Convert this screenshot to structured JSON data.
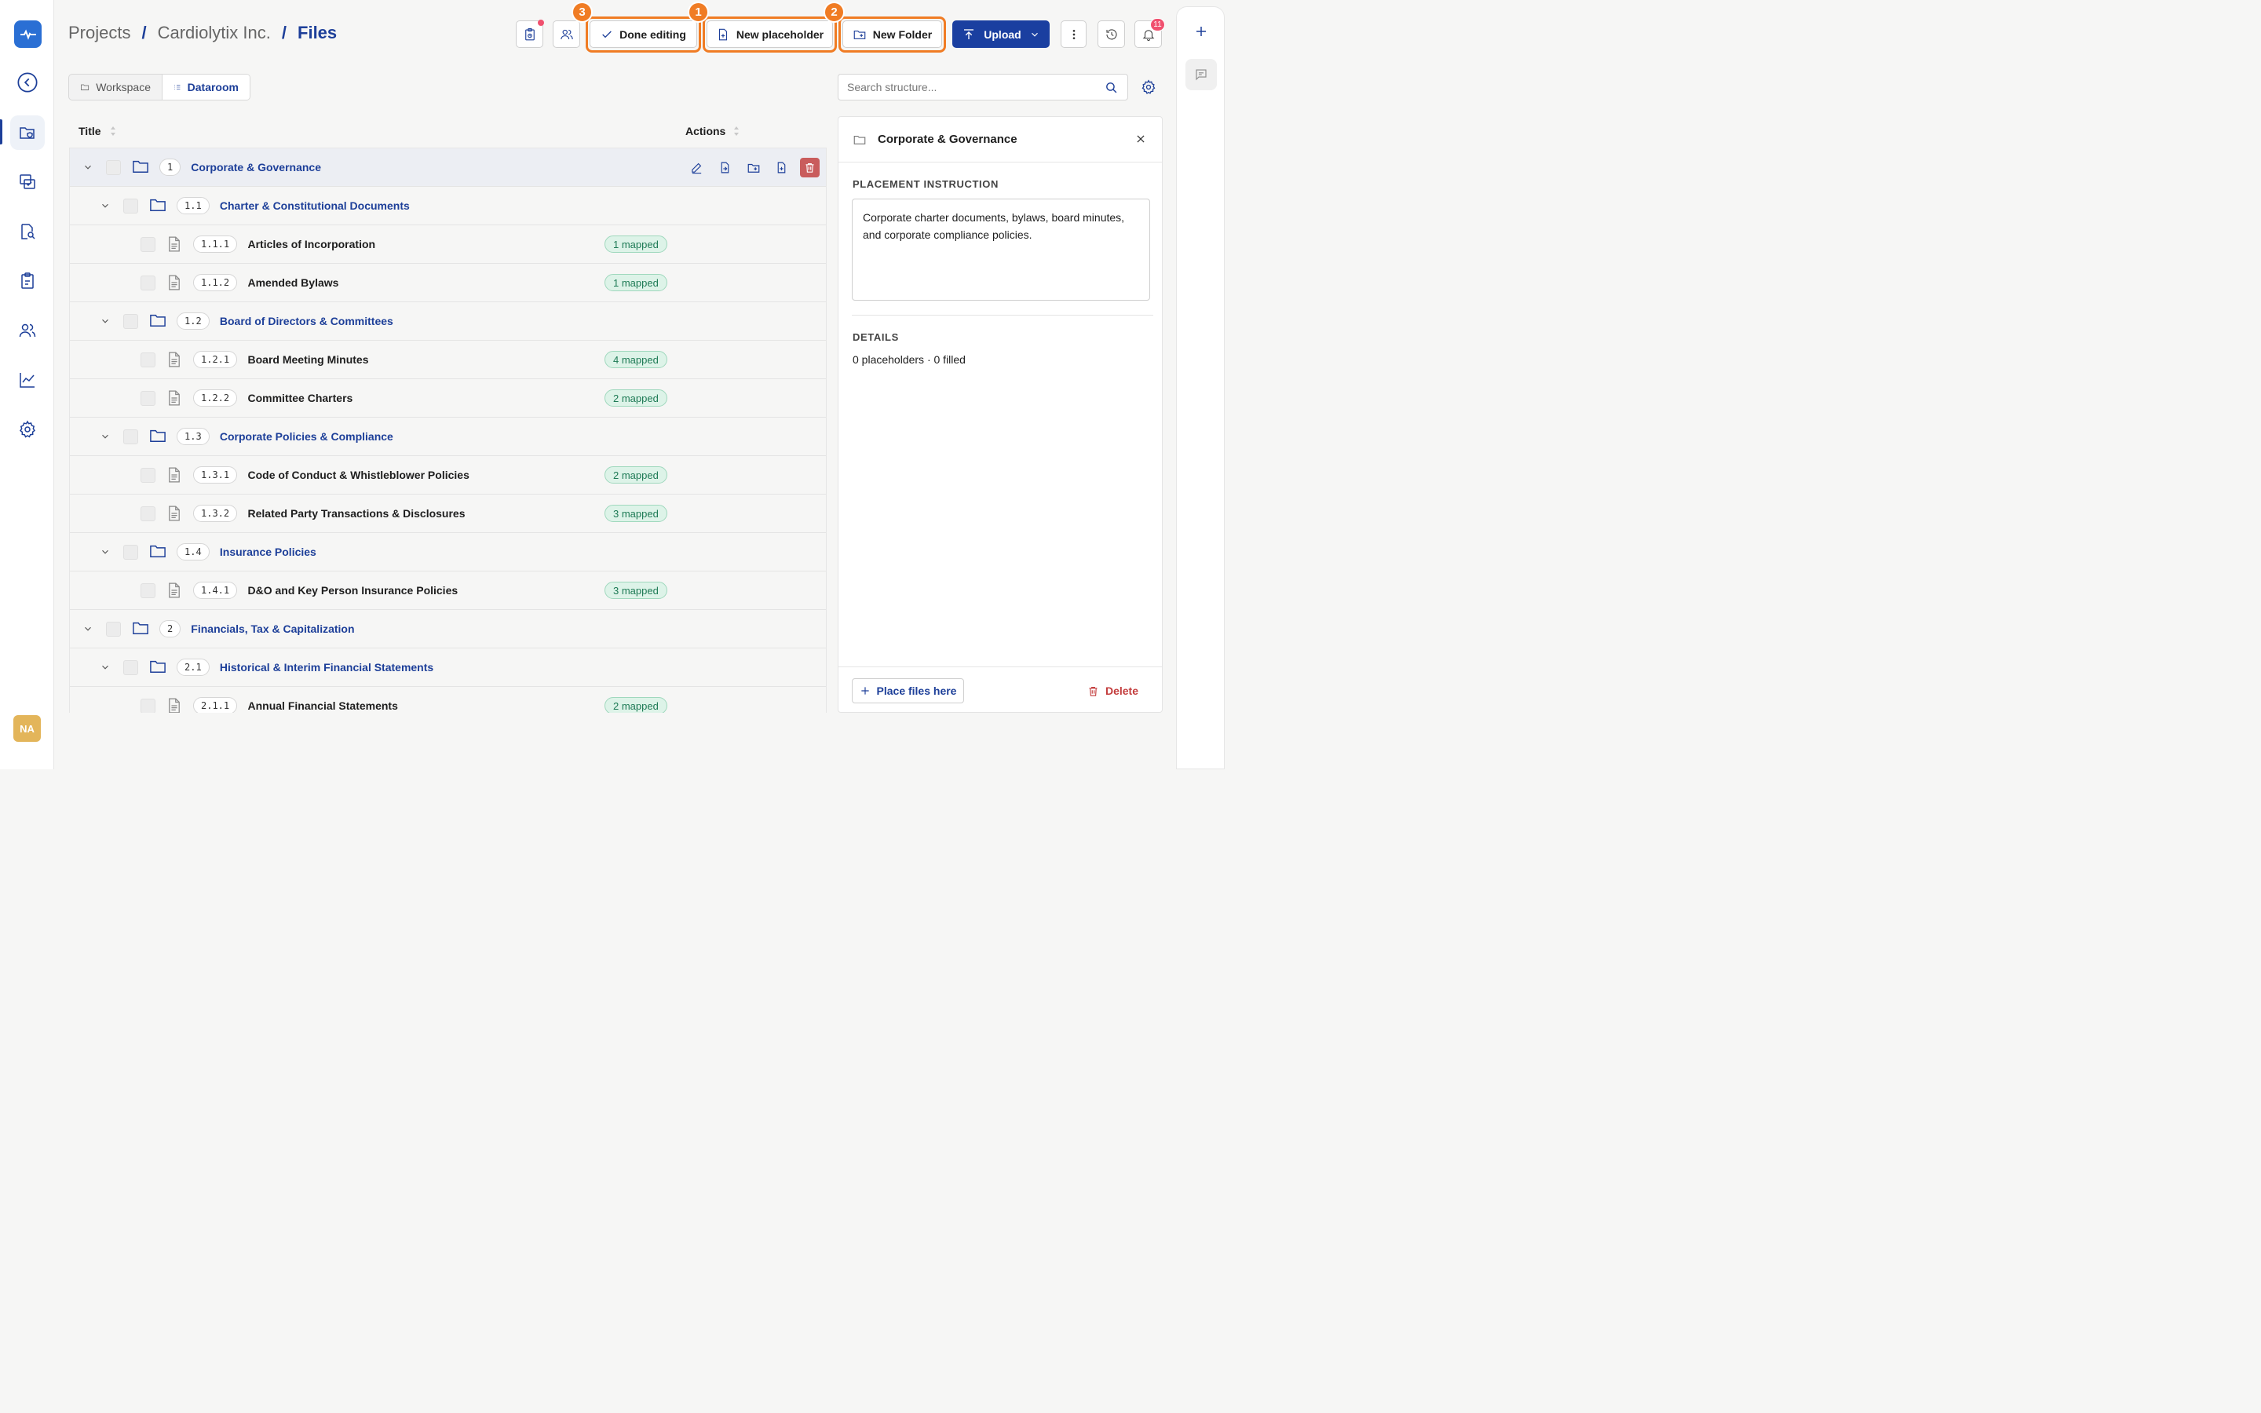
{
  "breadcrumb": {
    "projects": "Projects",
    "company": "Cardiolytix Inc.",
    "current": "Files",
    "sep": "/"
  },
  "header": {
    "done_editing": "Done editing",
    "new_placeholder": "New placeholder",
    "new_folder": "New Folder",
    "upload": "Upload",
    "notification_count": "11",
    "badges": {
      "done_editing": "3",
      "new_placeholder": "1",
      "new_folder": "2"
    }
  },
  "view_toggle": {
    "workspace": "Workspace",
    "dataroom": "Dataroom"
  },
  "table": {
    "col_title": "Title",
    "col_actions": "Actions"
  },
  "rows": [
    {
      "level": 0,
      "type": "folder",
      "num": "1",
      "title": "Corporate & Governance",
      "selected": true
    },
    {
      "level": 1,
      "type": "folder",
      "num": "1.1",
      "title": "Charter & Constitutional Documents"
    },
    {
      "level": 2,
      "type": "doc",
      "num": "1.1.1",
      "title": "Articles of Incorporation",
      "mapped": "1 mapped"
    },
    {
      "level": 2,
      "type": "doc",
      "num": "1.1.2",
      "title": "Amended Bylaws",
      "mapped": "1 mapped"
    },
    {
      "level": 1,
      "type": "folder",
      "num": "1.2",
      "title": "Board of Directors & Committees"
    },
    {
      "level": 2,
      "type": "doc",
      "num": "1.2.1",
      "title": "Board Meeting Minutes",
      "mapped": "4 mapped"
    },
    {
      "level": 2,
      "type": "doc",
      "num": "1.2.2",
      "title": "Committee Charters",
      "mapped": "2 mapped"
    },
    {
      "level": 1,
      "type": "folder",
      "num": "1.3",
      "title": "Corporate Policies & Compliance"
    },
    {
      "level": 2,
      "type": "doc",
      "num": "1.3.1",
      "title": "Code of Conduct & Whistleblower Policies",
      "mapped": "2 mapped"
    },
    {
      "level": 2,
      "type": "doc",
      "num": "1.3.2",
      "title": "Related Party Transactions & Disclosures",
      "mapped": "3 mapped"
    },
    {
      "level": 1,
      "type": "folder",
      "num": "1.4",
      "title": "Insurance Policies"
    },
    {
      "level": 2,
      "type": "doc",
      "num": "1.4.1",
      "title": "D&O and Key Person Insurance Policies",
      "mapped": "3 mapped"
    },
    {
      "level": 0,
      "type": "folder",
      "num": "2",
      "title": "Financials, Tax & Capitalization"
    },
    {
      "level": 1,
      "type": "folder",
      "num": "2.1",
      "title": "Historical & Interim Financial Statements"
    },
    {
      "level": 2,
      "type": "doc",
      "num": "2.1.1",
      "title": "Annual Financial Statements",
      "mapped": "2 mapped"
    }
  ],
  "search": {
    "placeholder": "Search structure..."
  },
  "panel": {
    "title": "Corporate & Governance",
    "placement_label": "PLACEMENT INSTRUCTION",
    "placement_text": "Corporate charter documents, bylaws, board minutes, and corporate compliance policies.",
    "details_label": "DETAILS",
    "details_text": "0 placeholders · 0 filled",
    "place_files": "Place files here",
    "delete": "Delete"
  },
  "user": {
    "initials": "NA"
  },
  "colors": {
    "accent": "#1d3f99",
    "highlight": "#f07c24",
    "mapped_bg": "#ddf3e8",
    "danger": "#c95c5c"
  }
}
